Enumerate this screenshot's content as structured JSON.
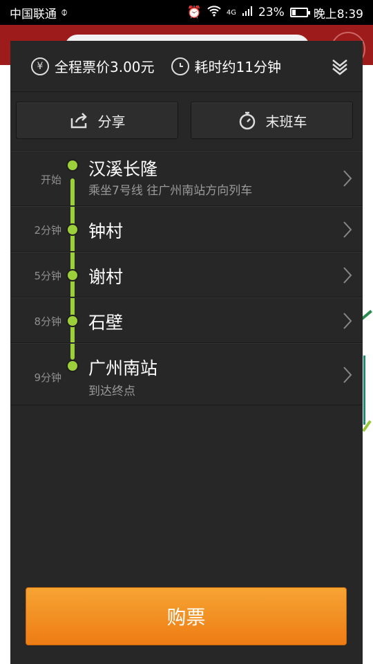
{
  "status": {
    "carrier": "中国联通",
    "battery": "23%",
    "time": "晚上8:39",
    "network": "4G"
  },
  "summary": {
    "fare": "全程票价3.00元",
    "duration": "耗时约11分钟"
  },
  "actions": {
    "share": "分享",
    "last_train": "末班车"
  },
  "stops": [
    {
      "time": "开始",
      "name": "汉溪长隆",
      "sub": "乘坐7号线 往广州南站方向列车"
    },
    {
      "time": "2分钟",
      "name": "钟村",
      "sub": ""
    },
    {
      "time": "5分钟",
      "name": "谢村",
      "sub": ""
    },
    {
      "time": "8分钟",
      "name": "石壁",
      "sub": ""
    },
    {
      "time": "9分钟",
      "name": "广州南站",
      "sub": "到达终点"
    }
  ],
  "buy_label": "购票",
  "colors": {
    "line": "#9bd03b",
    "button": "#f39224",
    "panel": "#272727"
  }
}
